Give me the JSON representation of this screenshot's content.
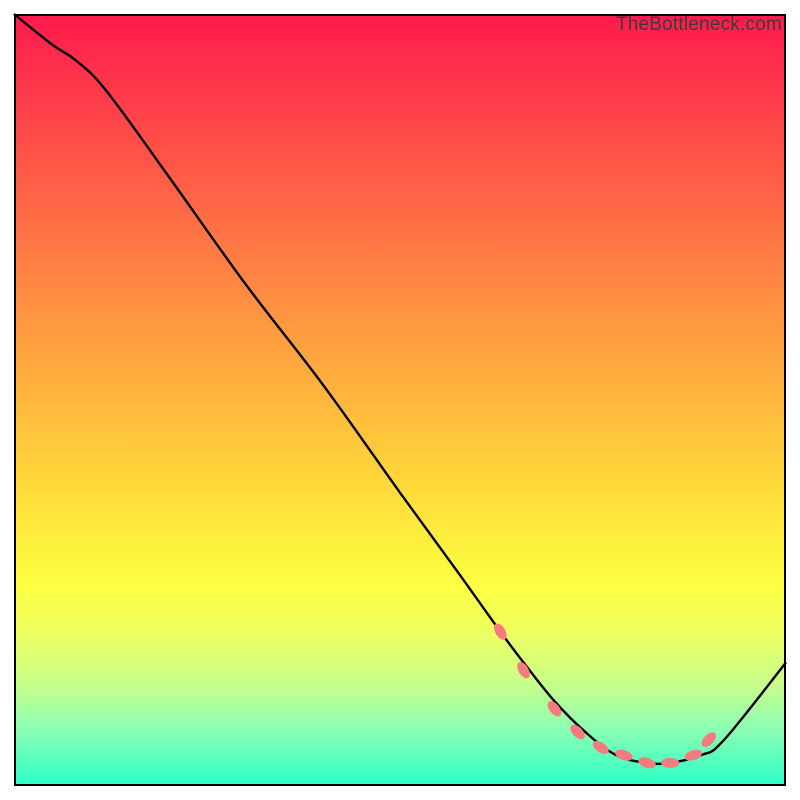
{
  "watermark": "TheBottleneck.com",
  "chart_data": {
    "type": "line",
    "title": "",
    "xlabel": "",
    "ylabel": "",
    "xlim": [
      0,
      100
    ],
    "ylim": [
      0,
      100
    ],
    "series": [
      {
        "name": "curve",
        "x": [
          0,
          5,
          8,
          12,
          20,
          30,
          40,
          50,
          58,
          63,
          66,
          70,
          74,
          78,
          82,
          85,
          89,
          92,
          100
        ],
        "y": [
          100,
          96,
          94,
          90,
          79,
          65,
          52,
          38,
          27,
          20,
          16,
          11,
          7,
          4,
          3,
          3,
          4,
          6,
          16
        ]
      }
    ],
    "markers": {
      "name": "dots",
      "x": [
        63,
        66,
        70,
        73,
        76,
        79,
        82,
        85,
        88,
        90
      ],
      "y": [
        20,
        15,
        10,
        7,
        5,
        4,
        3,
        3,
        4,
        6
      ]
    },
    "colors": {
      "line": "#000000",
      "marker_fill": "#f57c7c",
      "marker_stroke": "#d85a5a"
    }
  }
}
